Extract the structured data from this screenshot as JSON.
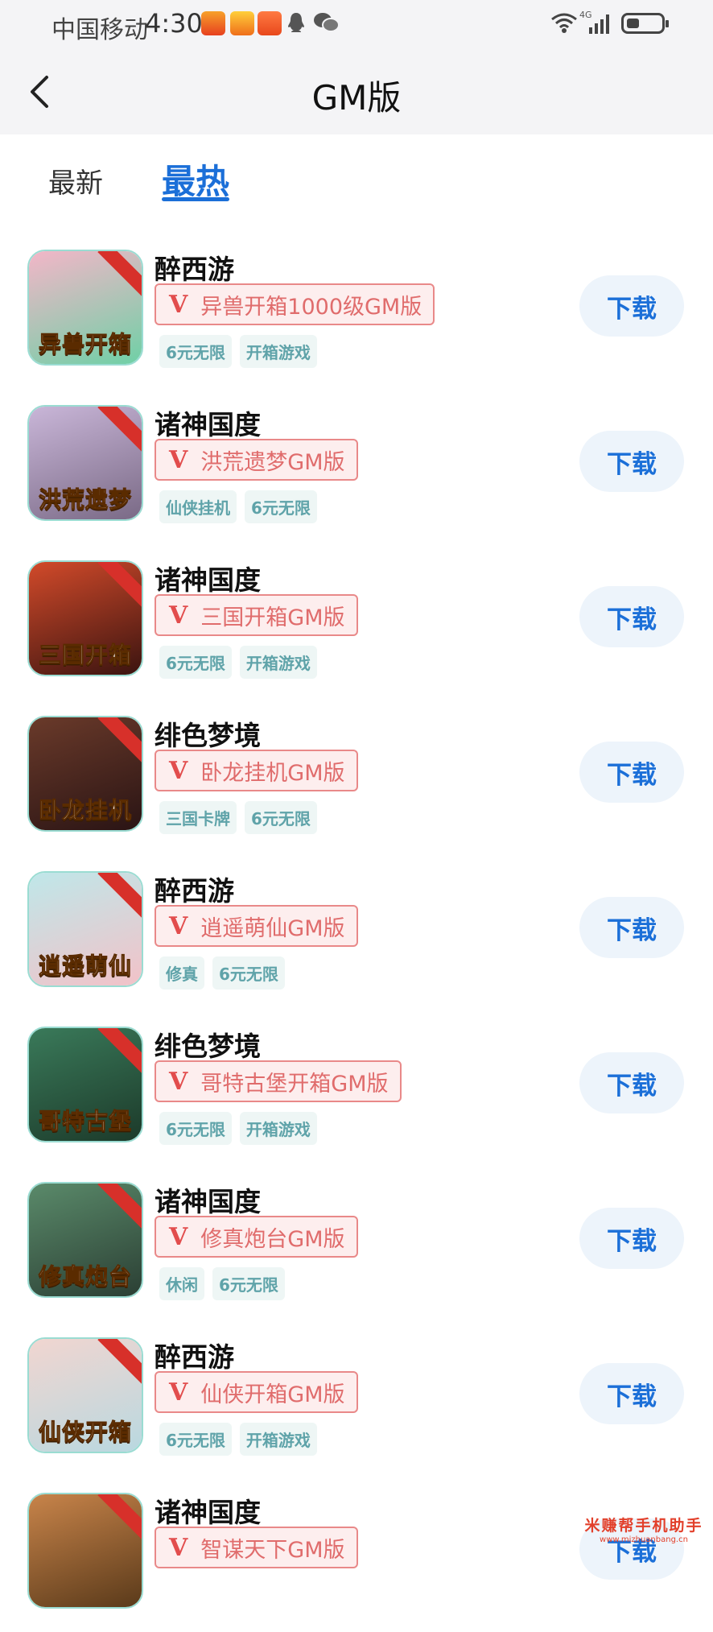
{
  "status_bar": {
    "carrier": "中国移动",
    "time": "4:30",
    "network": "4G",
    "battery_level": 0.35
  },
  "header": {
    "title": "GM版",
    "back_icon": "chevron-left-icon"
  },
  "tabs": [
    {
      "label": "最新",
      "active": false
    },
    {
      "label": "最热",
      "active": true
    }
  ],
  "games": [
    {
      "publisher": "醉西游",
      "name": "异兽开箱1000级GM版",
      "tags": [
        "6元无限",
        "开箱游戏"
      ],
      "icon_text": "异兽开箱",
      "download_label": "下载",
      "icon_colors": [
        "#f3b6c8",
        "#6fd0a6"
      ]
    },
    {
      "publisher": "诸神国度",
      "name": "洪荒遗梦GM版",
      "tags": [
        "仙侠挂机",
        "6元无限"
      ],
      "icon_text": "洪荒遗梦",
      "download_label": "下载",
      "icon_colors": [
        "#c9b6d8",
        "#7a6a86"
      ]
    },
    {
      "publisher": "诸神国度",
      "name": "三国开箱GM版",
      "tags": [
        "6元无限",
        "开箱游戏"
      ],
      "icon_text": "三国开箱",
      "download_label": "下载",
      "icon_colors": [
        "#d24a2a",
        "#3b1410"
      ]
    },
    {
      "publisher": "绯色梦境",
      "name": "卧龙挂机GM版",
      "tags": [
        "三国卡牌",
        "6元无限"
      ],
      "icon_text": "卧龙挂机",
      "download_label": "下载",
      "icon_colors": [
        "#6a3a2a",
        "#2a1414"
      ]
    },
    {
      "publisher": "醉西游",
      "name": "逍遥萌仙GM版",
      "tags": [
        "修真",
        "6元无限"
      ],
      "icon_text": "逍遥萌仙",
      "download_label": "下载",
      "icon_colors": [
        "#bfe7e9",
        "#f2c2c8"
      ]
    },
    {
      "publisher": "绯色梦境",
      "name": "哥特古堡开箱GM版",
      "tags": [
        "6元无限",
        "开箱游戏"
      ],
      "icon_text": "哥特古堡",
      "download_label": "下载",
      "icon_colors": [
        "#3a7a5a",
        "#1c3a2a"
      ]
    },
    {
      "publisher": "诸神国度",
      "name": "修真炮台GM版",
      "tags": [
        "休闲",
        "6元无限"
      ],
      "icon_text": "修真炮台",
      "download_label": "下载",
      "icon_colors": [
        "#5a8a6a",
        "#2b3f34"
      ]
    },
    {
      "publisher": "醉西游",
      "name": "仙侠开箱GM版",
      "tags": [
        "6元无限",
        "开箱游戏"
      ],
      "icon_text": "仙侠开箱",
      "download_label": "下载",
      "icon_colors": [
        "#f1d6d0",
        "#b9d8e0"
      ]
    },
    {
      "publisher": "诸神国度",
      "name": "智谋天下GM版",
      "tags": [],
      "icon_text": "",
      "download_label": "下载",
      "icon_colors": [
        "#c8844a",
        "#5a3a1a"
      ]
    }
  ],
  "watermark": {
    "line1": "米赚帮手机助手",
    "line2": "www.mizhuanbang.cn"
  }
}
